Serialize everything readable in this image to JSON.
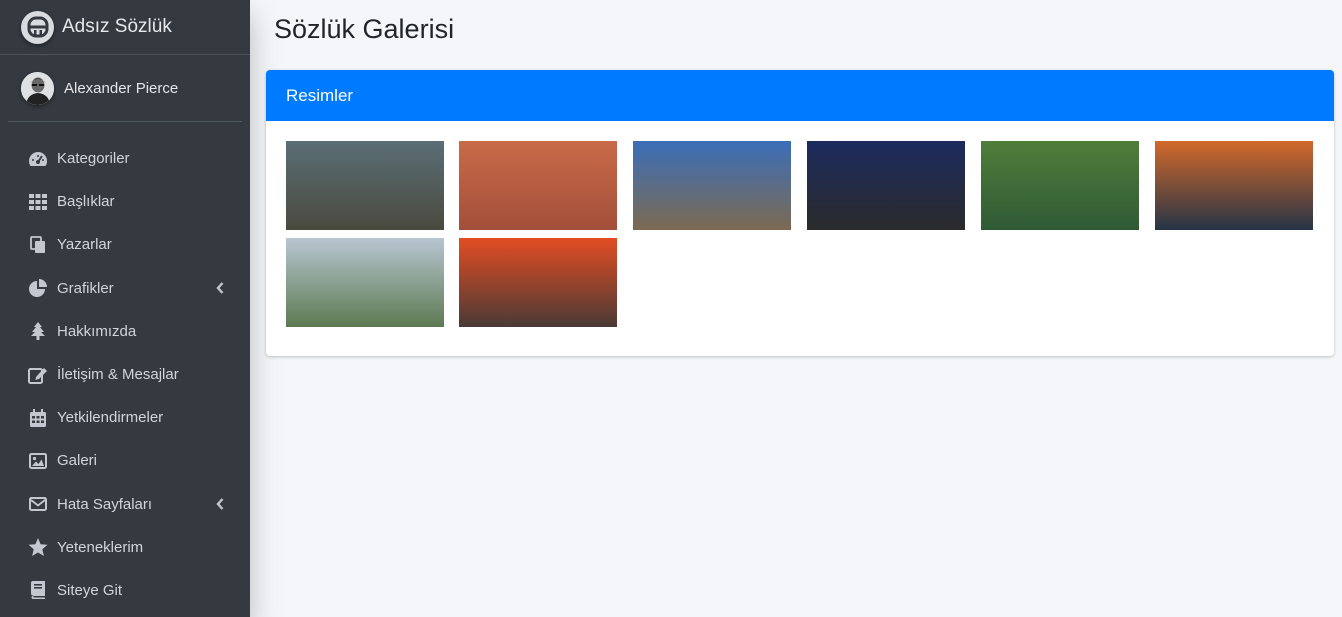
{
  "brand": {
    "name": "Adsız Sözlük",
    "logo_icon": "rounded-letter-a-icon"
  },
  "user": {
    "name": "Alexander Pierce",
    "avatar_icon": "user-avatar-photo"
  },
  "sidebar": {
    "items": [
      {
        "label": "Kategoriler",
        "icon": "tachometer-icon",
        "has_arrow": false
      },
      {
        "label": "Başlıklar",
        "icon": "grid-icon",
        "has_arrow": false
      },
      {
        "label": "Yazarlar",
        "icon": "copy-icon",
        "has_arrow": false
      },
      {
        "label": "Grafikler",
        "icon": "pie-chart-icon",
        "has_arrow": true
      },
      {
        "label": "Hakkımızda",
        "icon": "tree-icon",
        "has_arrow": false
      },
      {
        "label": "İletişim & Mesajlar",
        "icon": "edit-icon",
        "has_arrow": false
      },
      {
        "label": "Yetkilendirmeler",
        "icon": "calendar-icon",
        "has_arrow": false
      },
      {
        "label": "Galeri",
        "icon": "image-icon",
        "has_arrow": false
      },
      {
        "label": "Hata Sayfaları",
        "icon": "envelope-icon",
        "has_arrow": true
      },
      {
        "label": "Yeteneklerim",
        "icon": "star-icon",
        "has_arrow": false
      },
      {
        "label": "Siteye Git",
        "icon": "book-icon",
        "has_arrow": false
      }
    ]
  },
  "page": {
    "title": "Sözlük Galerisi"
  },
  "card": {
    "header": "Resimler"
  },
  "gallery": {
    "images": [
      {
        "name": "gallery-image-city-aerial",
        "top": "#5a6e76",
        "bottom": "#4a4a3e"
      },
      {
        "name": "gallery-image-nemrut-statues",
        "top": "#c86a48",
        "bottom": "#a44f3b"
      },
      {
        "name": "gallery-image-trojan-horse",
        "top": "#3b6eb8",
        "bottom": "#7c6a52"
      },
      {
        "name": "gallery-image-clock-tower-night",
        "top": "#1c2b5e",
        "bottom": "#2b2b2b"
      },
      {
        "name": "gallery-image-stone-bridge-river",
        "top": "#4f7e3a",
        "bottom": "#2f5a35"
      },
      {
        "name": "gallery-image-sunset-coast",
        "top": "#d2692a",
        "bottom": "#263447"
      },
      {
        "name": "gallery-image-river-city",
        "top": "#b8c6d1",
        "bottom": "#5c7a52"
      },
      {
        "name": "gallery-image-sea-sunset",
        "top": "#e24d23",
        "bottom": "#4a3a36"
      }
    ]
  }
}
